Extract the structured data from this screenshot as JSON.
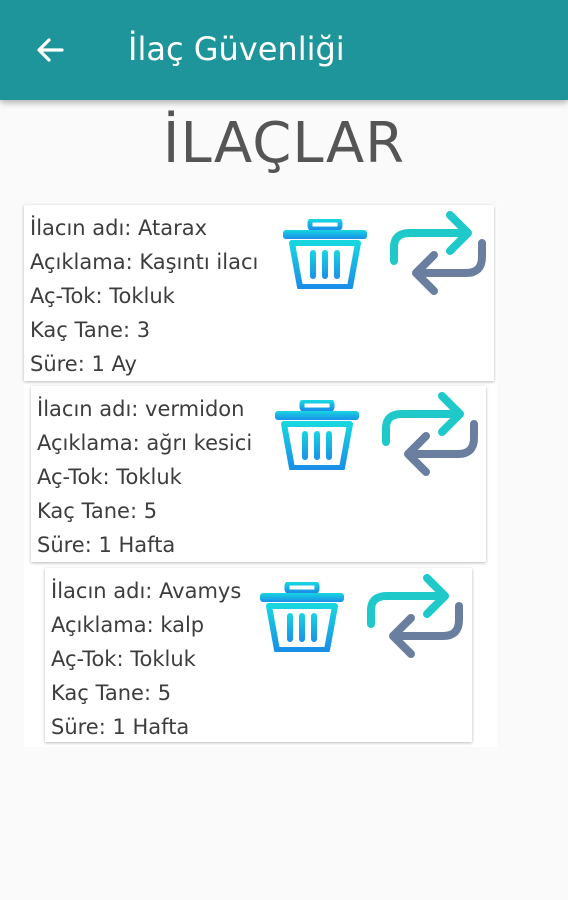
{
  "appbar": {
    "title": "İlaç Güvenliği",
    "back_icon": "arrow-back-icon",
    "background": "#1e959a"
  },
  "page": {
    "heading": "İLAÇLAR"
  },
  "icons": {
    "delete": "trash-icon",
    "swap": "swap-arrows-icon",
    "delete_color_top": "#17d6e0",
    "delete_color_bottom": "#1a8fe8",
    "swap_color_top": "#20c9c9",
    "swap_color_bottom": "#6a7fa0"
  },
  "medicines": [
    {
      "name": "İlacın adı: Atarax",
      "description": "Açıklama: Kaşıntı ilacı",
      "fasting": "Aç-Tok: Tokluk",
      "count": "Kaç Tane: 3",
      "duration": "Süre: 1 Ay"
    },
    {
      "name": "İlacın adı: vermidon",
      "description": "Açıklama: ağrı kesici",
      "fasting": "Aç-Tok: Tokluk",
      "count": "Kaç Tane: 5",
      "duration": "Süre: 1 Hafta"
    },
    {
      "name": "İlacın adı: Avamys",
      "description": "Açıklama: kalp",
      "fasting": "Aç-Tok: Tokluk",
      "count": "Kaç Tane: 5",
      "duration": "Süre: 1 Hafta"
    }
  ]
}
